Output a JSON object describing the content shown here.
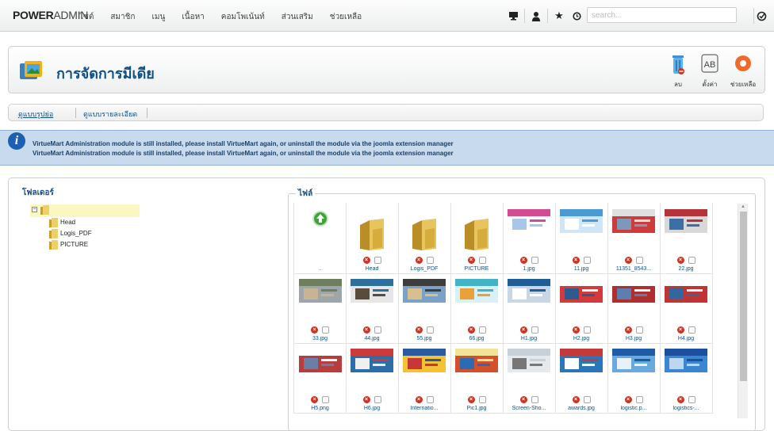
{
  "app": {
    "brand_bold": "POWER",
    "brand_light": "ADMIN"
  },
  "menu": [
    "ไซต์",
    "สมาชิก",
    "เมนู",
    "เนื้อหา",
    "คอมโพเน้นท์",
    "ส่วนเสริม",
    "ช่วยเหลือ"
  ],
  "toolbar_icons": [
    "monitor-icon",
    "user-icon",
    "star-icon",
    "clock-icon"
  ],
  "search": {
    "placeholder": "search..."
  },
  "page": {
    "title": "การจัดการมีเดีย"
  },
  "actions": [
    {
      "label": "ลบ",
      "icon": "trash-icon"
    },
    {
      "label": "ตั้งค่า",
      "icon": "settings-icon"
    },
    {
      "label": "ช่วยเหลือ",
      "icon": "help-lifebuoy-icon"
    }
  ],
  "tabs": [
    {
      "label": "ดูแบบรูปย่อ",
      "active": true
    },
    {
      "label": "ดูแบบรายละเอียด",
      "active": false
    }
  ],
  "notice": {
    "lines": [
      "VirtueMart Administration module is still installed, please install VirtueMart again, or uninstall the module via the joomla extension manager",
      "VirtueMart Administration module is still installed, please install VirtueMart again, or uninstall the module via the joomla extension manager"
    ]
  },
  "folders_panel": {
    "title": "โฟลเดอร์",
    "tree": [
      "Head",
      "Logis_PDF",
      "PICTURE"
    ]
  },
  "files_panel": {
    "title": "ไฟล์",
    "items": [
      {
        "name": "..",
        "kind": "up"
      },
      {
        "name": "Head",
        "kind": "folder"
      },
      {
        "name": "Logis_PDF",
        "kind": "folder"
      },
      {
        "name": "PICTURE",
        "kind": "folder"
      },
      {
        "name": "1.jpg",
        "kind": "image"
      },
      {
        "name": "11.jpg",
        "kind": "image"
      },
      {
        "name": "11351_8543...",
        "kind": "image"
      },
      {
        "name": "22.jpg",
        "kind": "image"
      },
      {
        "name": "33.jpg",
        "kind": "image"
      },
      {
        "name": "44.jpg",
        "kind": "image"
      },
      {
        "name": "55.jpg",
        "kind": "image"
      },
      {
        "name": "66.jpg",
        "kind": "image"
      },
      {
        "name": "H1.jpg",
        "kind": "image"
      },
      {
        "name": "H2.jpg",
        "kind": "image"
      },
      {
        "name": "H3.jpg",
        "kind": "image"
      },
      {
        "name": "H4.jpg",
        "kind": "image"
      },
      {
        "name": "H5.png",
        "kind": "image"
      },
      {
        "name": "H6.jpg",
        "kind": "image"
      },
      {
        "name": "Internatio...",
        "kind": "image"
      },
      {
        "name": "Pic1.jpg",
        "kind": "image"
      },
      {
        "name": "Screen-Sho...",
        "kind": "image"
      },
      {
        "name": "awards.jpg",
        "kind": "image"
      },
      {
        "name": "logistic.p...",
        "kind": "image"
      },
      {
        "name": "logistics-...",
        "kind": "image"
      }
    ]
  },
  "colors": {
    "accent": "#124f86",
    "notice_bg": "#c7daee",
    "delete": "#d2321f",
    "tree_highlight": "#fbf7c3"
  }
}
